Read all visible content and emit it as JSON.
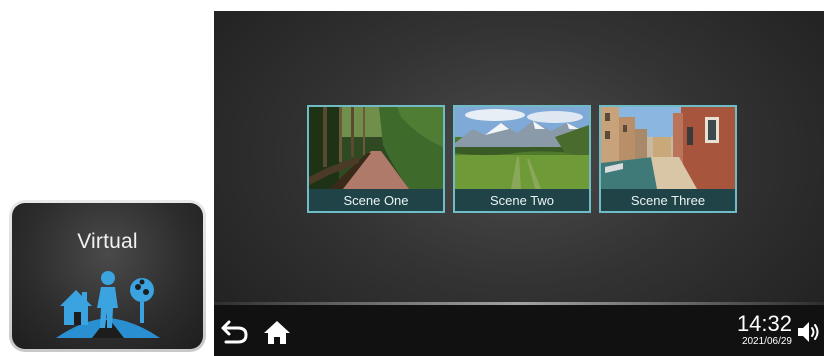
{
  "mode_tile": {
    "label": "Virtual",
    "icon": "virtual-walk-icon",
    "accent": "#3aa3e0"
  },
  "scenes": [
    {
      "label": "Scene One",
      "thumbnail": "forest-path"
    },
    {
      "label": "Scene Two",
      "thumbnail": "mountain-meadow"
    },
    {
      "label": "Scene Three",
      "thumbnail": "canal-street"
    }
  ],
  "bottom_bar": {
    "back_icon": "back-arrow-icon",
    "home_icon": "home-icon",
    "time": "14:32",
    "date": "2021/06/29",
    "volume_icon": "speaker-icon"
  },
  "colors": {
    "card_border": "#6fbcc6",
    "caption_bg": "#1f4347"
  }
}
